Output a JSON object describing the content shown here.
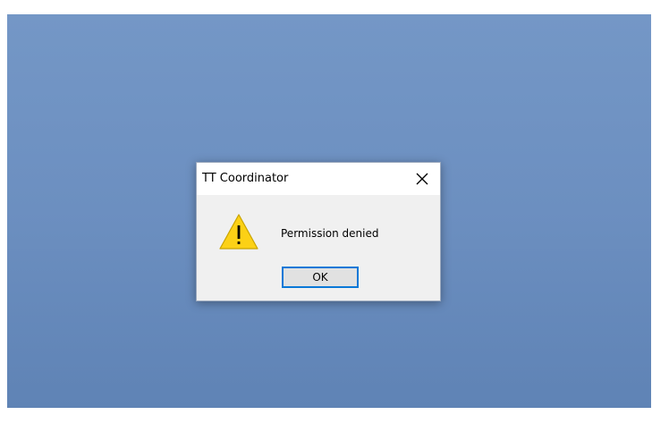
{
  "dialog": {
    "title": "TT Coordinator",
    "message": "Permission denied",
    "ok_label": "OK",
    "icon": "warning-icon",
    "close_icon": "close-icon"
  },
  "colors": {
    "desktop_top": "#7497c6",
    "desktop_bottom": "#5f83b5",
    "dialog_body": "#f0f0f0",
    "titlebar": "#ffffff",
    "button_focus_border": "#0a78d7",
    "warning_fill": "#fcd116"
  }
}
